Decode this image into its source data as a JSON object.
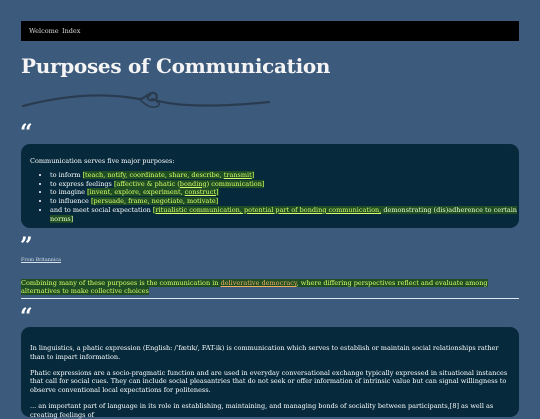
{
  "nav": {
    "welcome": "Welcome",
    "index": "Index"
  },
  "page": {
    "title": "Purposes of Communication"
  },
  "quote1": {
    "intro": "Communication serves five major purposes:",
    "items": [
      {
        "pre": "to inform ",
        "hl": "[teach, notify, coordinate, share, describe, ",
        "link": "transmit",
        "post": "]"
      },
      {
        "pre": "to express feelings ",
        "hl": "[affective & phatic (",
        "link": "bonding",
        "post": ") communication]"
      },
      {
        "pre": "to imagine ",
        "hl": "[invent, explore, experiment, ",
        "link": "construct",
        "post": "]"
      },
      {
        "pre": "to influence ",
        "hl": "[persuade, frame, negotiate, motivate]",
        "link": "",
        "post": ""
      },
      {
        "pre": "and to meet social expectation ",
        "hl": "[",
        "link": "ritualistic communication, potential part of bonding communication,",
        "post": " demonstrating (dis)adherence to certain norms]"
      }
    ]
  },
  "source": "From Britannica",
  "combine": {
    "pre": "Combining many of these purposes is the communication in ",
    "link": "deliverative democracy",
    "post": ", where differing perspectives reflect and evaluate among alternatives to make collective choices"
  },
  "quote2": {
    "p1": "In linguistics, a phatic expression (English: /ˈfætɪk/, FAT-ik) is communication which serves to establish or maintain social relationships rather than to impart information.",
    "p2": "Phatic expressions are a socio-pragmatic function and are used in everyday conversational exchange typically expressed in situational instances that call for social cues. They can include social pleasantries that do not seek or offer information of intrinsic value but can signal willingness to observe conventional local expectations for politeness.",
    "p3": "... an important part of language in its role in establishing, maintaining, and managing bonds of sociality between participants,[8] as well as creating feelings of"
  },
  "glyphs": {
    "open_quote": "“",
    "close_quote": "”"
  },
  "colors": {
    "background": "#3c5a7c",
    "panel": "#062a3c",
    "highlight": "#1f4d24",
    "highlight_text": "#d7ff6a",
    "link_orange": "#f0b060"
  },
  "icons": {
    "flourish": "decorative-flourish-icon"
  }
}
